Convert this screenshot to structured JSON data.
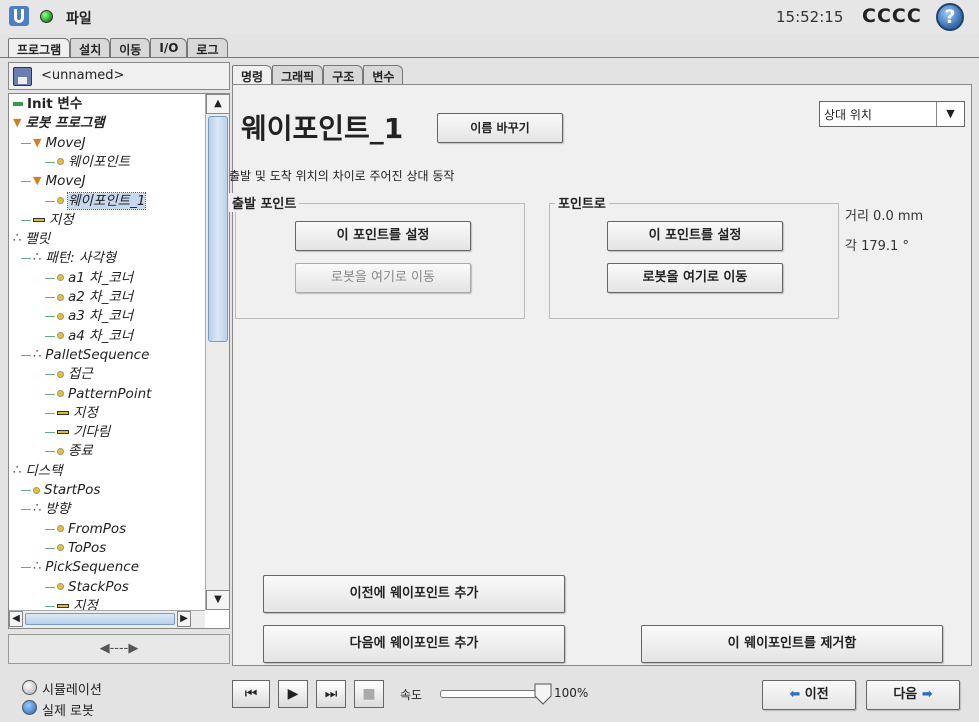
{
  "header": {
    "file_menu": "파일",
    "clock": "15:52:15",
    "robot_name": "CCCC",
    "help": "?"
  },
  "main_tabs": [
    "프로그램",
    "설치",
    "이동",
    "I/O",
    "로그"
  ],
  "program": {
    "name": "<unnamed>"
  },
  "tree": [
    {
      "label": "Init 변수",
      "icon": "init",
      "level": 0,
      "italic": false,
      "bold": true
    },
    {
      "label": "로봇 프로그램",
      "icon": "triangle",
      "level": 0,
      "italic": true,
      "bold": true
    },
    {
      "label": "MoveJ",
      "icon": "triangle",
      "level": 1,
      "italic": true
    },
    {
      "label": "웨이포인트",
      "icon": "dot",
      "level": 2,
      "italic": true
    },
    {
      "label": "MoveJ",
      "icon": "triangle",
      "level": 1,
      "italic": true
    },
    {
      "label": "웨이포인트_1",
      "icon": "dot",
      "level": 2,
      "italic": true,
      "selected": true
    },
    {
      "label": "지정",
      "icon": "dash",
      "level": 1,
      "italic": true
    },
    {
      "label": "팰릿",
      "icon": "cluster",
      "level": 0,
      "italic": true
    },
    {
      "label": "패턴: 사각형",
      "icon": "cluster",
      "level": 1,
      "italic": true
    },
    {
      "label": "a1 차_코너",
      "icon": "dot",
      "level": 2,
      "italic": true
    },
    {
      "label": "a2 차_코너",
      "icon": "dot",
      "level": 2,
      "italic": true
    },
    {
      "label": "a3 차_코너",
      "icon": "dot",
      "level": 2,
      "italic": true
    },
    {
      "label": "a4 차_코너",
      "icon": "dot",
      "level": 2,
      "italic": true
    },
    {
      "label": "PalletSequence",
      "icon": "cluster",
      "level": 1,
      "italic": true
    },
    {
      "label": "접근",
      "icon": "dot",
      "level": 2,
      "italic": true
    },
    {
      "label": "PatternPoint",
      "icon": "dot",
      "level": 2,
      "italic": true
    },
    {
      "label": "지정",
      "icon": "dash",
      "level": 2,
      "italic": true
    },
    {
      "label": "기다림",
      "icon": "dash",
      "level": 2,
      "italic": true
    },
    {
      "label": "종료",
      "icon": "dot",
      "level": 2,
      "italic": true
    },
    {
      "label": "디스택",
      "icon": "cluster",
      "level": 0,
      "italic": true
    },
    {
      "label": "StartPos",
      "icon": "dot",
      "level": 1,
      "italic": true
    },
    {
      "label": "방향",
      "icon": "cluster",
      "level": 1,
      "italic": true
    },
    {
      "label": "FromPos",
      "icon": "dot",
      "level": 2,
      "italic": true
    },
    {
      "label": "ToPos",
      "icon": "dot",
      "level": 2,
      "italic": true
    },
    {
      "label": "PickSequence",
      "icon": "cluster",
      "level": 1,
      "italic": true
    },
    {
      "label": "StackPos",
      "icon": "dot",
      "level": 2,
      "italic": true
    },
    {
      "label": "지정",
      "icon": "dash",
      "level": 2,
      "italic": true
    }
  ],
  "sub_tabs": [
    "명령",
    "그래픽",
    "구조",
    "변수"
  ],
  "waypoint": {
    "title": "웨이포인트_1",
    "rename_button": "이름 바꾸기",
    "type_select": "상대 위치",
    "description": "출발 및 도착 위치의 차이로 주어진 상대 동작",
    "from_group": "출발 포인트",
    "to_group": "포인트로",
    "set_point": "이 포인트를 설정",
    "move_here": "로봇을 여기로 이동",
    "distance": "거리 0.0 mm",
    "angle": "각 179.1 °",
    "add_before": "이전에 웨이포인트 추가",
    "add_after": "다음에 웨이포인트 추가",
    "remove": "이 웨이포인트를 제거함"
  },
  "footer": {
    "simulation": "시뮬레이션",
    "real_robot": "실제 로봇",
    "speed_label": "속도",
    "speed_text": "100%",
    "speed_fraction": 1.0,
    "prev": "이전",
    "next": "다음"
  },
  "colors": {
    "tree_icon_green": "#3a9a4a",
    "tree_dot_yellow": "#e8c030",
    "triangle_orange": "#d08020",
    "selected_bg": "#c8d8ee",
    "arrow_blue": "#2a6fc0"
  }
}
